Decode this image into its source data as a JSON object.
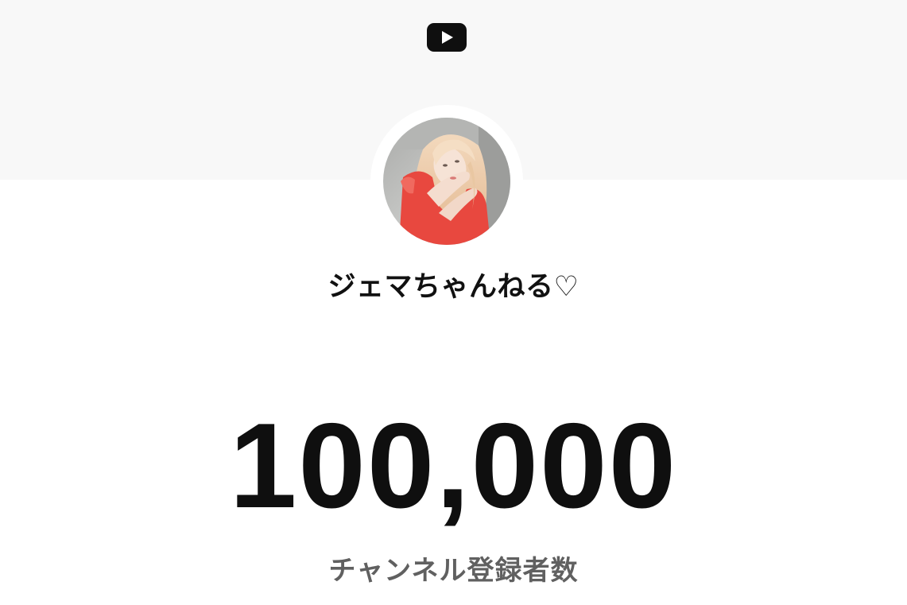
{
  "header": {
    "logo_icon": "youtube-play-icon",
    "banner_color": "#f8f8f8",
    "logo_color": "#0f0f0f"
  },
  "channel": {
    "avatar_icon": "channel-avatar",
    "name": "ジェマちゃんねる♡"
  },
  "stats": {
    "subscriber_count": "100,000",
    "subscriber_label": "チャンネル登録者数"
  }
}
